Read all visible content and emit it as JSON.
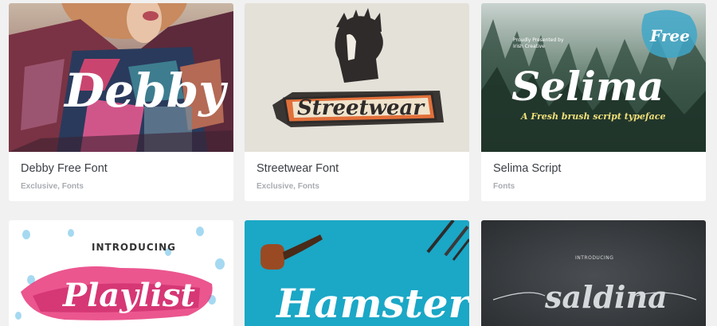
{
  "cards": [
    {
      "title": "Debby Free Font",
      "categories": [
        "Exclusive",
        "Fonts"
      ],
      "preview": {
        "word": "Debby"
      }
    },
    {
      "title": "Streetwear Font",
      "categories": [
        "Exclusive",
        "Fonts"
      ],
      "preview": {
        "word": "Streetwear"
      }
    },
    {
      "title": "Selima Script",
      "categories": [
        "Fonts"
      ],
      "preview": {
        "word": "Selima",
        "badge": "Free",
        "tagline": "A Fresh brush script typeface",
        "credit_line1": "Proudly Presented by",
        "credit_line2": "Irish Creative"
      }
    },
    {
      "preview": {
        "word": "Playlist",
        "intro": "INTRODUCING"
      }
    },
    {
      "preview": {
        "word": "Hamster"
      }
    },
    {
      "preview": {
        "word": "saldina",
        "intro": "INTRODUCING"
      }
    }
  ],
  "colors": {
    "page_bg": "#f1f1f1",
    "card_bg": "#ffffff",
    "title_text": "#3b3f45",
    "meta_text": "#a8acb1",
    "streetwear_orange": "#e2703a",
    "hamster_teal": "#1ba7c6",
    "playlist_pink": "#e8387b",
    "selima_forest": "#4f6a5a"
  }
}
